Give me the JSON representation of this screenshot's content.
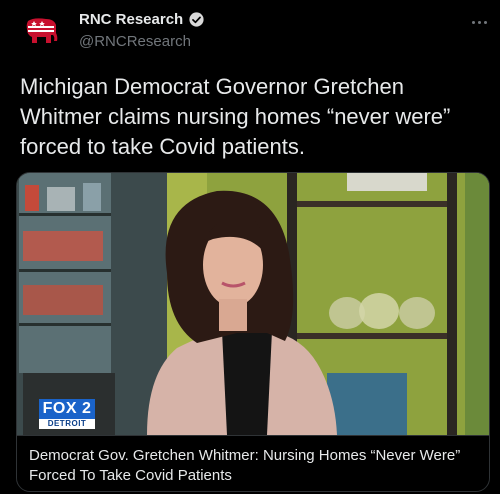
{
  "author": {
    "name": "RNC Research",
    "handle": "@RNCResearch",
    "avatar_icon": "gop-elephant-icon",
    "verified_icon": "verified-badge-icon"
  },
  "tweet": {
    "text": "Michigan Democrat Governor Gretchen Whitmer claims nursing homes “never were” forced to take Covid patients."
  },
  "card": {
    "title": "Democrat Gov. Gretchen Whitmer: Nursing Homes “Never Were” Forced To Take Covid Patients",
    "logo": {
      "top": "FOX 2",
      "bottom": "DETROIT"
    }
  },
  "colors": {
    "background": "#000000",
    "text": "#e7e9ea",
    "muted": "#71767b",
    "verified": "#d9d9d9",
    "gop_red": "#c8102e"
  }
}
